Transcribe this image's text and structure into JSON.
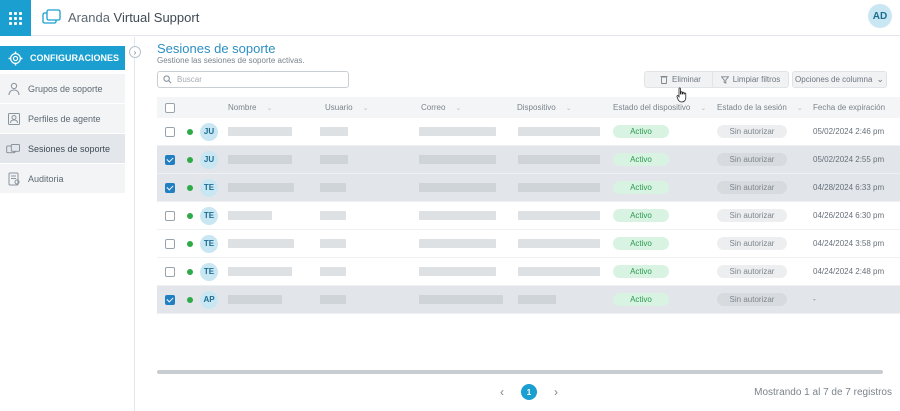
{
  "header": {
    "brand_light": "Aranda",
    "brand_bold": "Virtual Support",
    "user_initials": "AD"
  },
  "sidebar": {
    "title": "CONFIGURACIONES",
    "items": [
      {
        "label": "Grupos de soporte",
        "icon": "support-group-icon",
        "active": false
      },
      {
        "label": "Perfiles de agente",
        "icon": "agent-profile-icon",
        "active": false
      },
      {
        "label": "Sesiones de soporte",
        "icon": "support-sessions-icon",
        "active": true
      },
      {
        "label": "Auditoria",
        "icon": "audit-icon",
        "active": false
      }
    ]
  },
  "main": {
    "title": "Sesiones de soporte",
    "subtitle": "Gestione las sesiones de soporte activas.",
    "search_placeholder": "Buscar",
    "toolbar": {
      "delete_label": "Eliminar",
      "clear_label": "Limpiar filtros",
      "columns_label": "Opciones de columna"
    }
  },
  "table": {
    "columns": [
      "Nombre",
      "Usuario",
      "Correo",
      "Dispositivo",
      "Estado del dispositivo",
      "Estado de la sesión",
      "Fecha de expiración"
    ],
    "rows": [
      {
        "checked": false,
        "initials": "JU",
        "device_status": "Activo",
        "session_status": "Sin autorizar",
        "expiration": "05/02/2024 2:46 pm"
      },
      {
        "checked": true,
        "initials": "JU",
        "device_status": "Activo",
        "session_status": "Sin autorizar",
        "expiration": "05/02/2024 2:55 pm"
      },
      {
        "checked": true,
        "initials": "TE",
        "device_status": "Activo",
        "session_status": "Sin autorizar",
        "expiration": "04/28/2024 6:33 pm"
      },
      {
        "checked": false,
        "initials": "TE",
        "device_status": "Activo",
        "session_status": "Sin autorizar",
        "expiration": "04/26/2024 6:30 pm"
      },
      {
        "checked": false,
        "initials": "TE",
        "device_status": "Activo",
        "session_status": "Sin autorizar",
        "expiration": "04/24/2024 3:58 pm"
      },
      {
        "checked": false,
        "initials": "TE",
        "device_status": "Activo",
        "session_status": "Sin autorizar",
        "expiration": "04/24/2024 2:48 pm"
      },
      {
        "checked": true,
        "initials": "AP",
        "device_status": "Activo",
        "session_status": "Sin autorizar",
        "expiration": "-"
      }
    ]
  },
  "pagination": {
    "current_page": "1",
    "summary": "Mostrando 1 al 7 de 7 registros"
  },
  "colors": {
    "accent": "#1a9fd0",
    "title": "#2c8fc2",
    "active_green": "#2eaa48"
  }
}
